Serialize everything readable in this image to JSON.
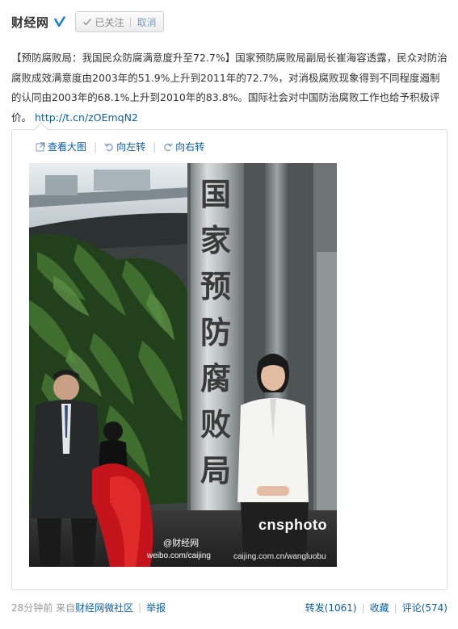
{
  "header": {
    "author": "财经网",
    "followed_label": "已关注",
    "separator": "|",
    "cancel_label": "取消"
  },
  "post": {
    "text": "【预防腐败局：我国民众防腐满意度升至72.7%】国家预防腐败局副局长崔海容透露，民众对防治腐败成效满意度由2003年的51.9%上升到2011年的72.7%，对消极腐败现象得到不同程度遏制的认同由2003年的68.1%上升到2010年的83.8%。国际社会对中国防治腐败工作也给予积极评价。",
    "link": "http://t.cn/zOEmqN2"
  },
  "media": {
    "view_large": "查看大图",
    "rotate_left": "向左转",
    "rotate_right": "向右转",
    "sign_text": [
      "国",
      "家",
      "预",
      "防",
      "腐",
      "败",
      "局"
    ],
    "watermark_brand": "cnsphoto",
    "watermark_handle": "@财经网",
    "watermark_site": "weibo.com/caijing",
    "watermark_url": "caijing.com.cn/wangluobu"
  },
  "footer": {
    "time_source": "28分钟前 来自",
    "source_name": "财经网微社区",
    "report": "举报",
    "repost": "转发(1061)",
    "favorite": "收藏",
    "comment": "评论(574)",
    "separator": "|"
  },
  "colors": {
    "link": "#0a5fa8",
    "verified": "#1a7fd0",
    "text": "#333333",
    "muted": "#999999"
  }
}
